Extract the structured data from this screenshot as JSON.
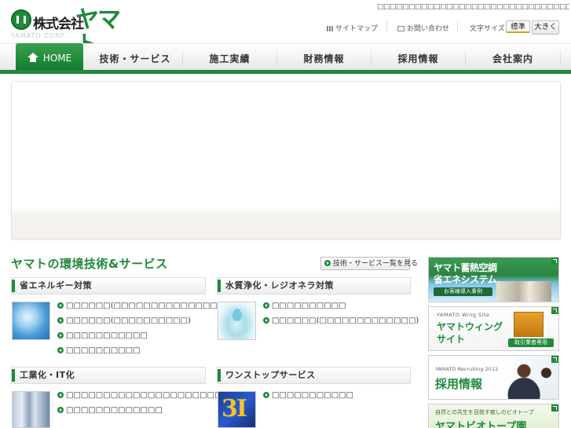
{
  "header": {
    "logo_corp": "株式会社",
    "logo_name": "ヤマト",
    "logo_sub": "YAMATO CORP.",
    "tagline": "□□□□□□□□□□□□□□□□□□□□□□□□□□□□□□□□□□□ □□□□□□□□□□□□□□□□□□□□□",
    "sitemap": "サイトマップ",
    "contact": "お問い合わせ",
    "font_size_label": "文字サイズ",
    "font_standard": "標準",
    "font_large": "大きく"
  },
  "nav": {
    "home": "HOME",
    "items": [
      "技術・サービス",
      "施工実績",
      "財務情報",
      "採用情報",
      "会社案内"
    ]
  },
  "section": {
    "title": "ヤマトの環境技術&サービス",
    "list_button": "技術・サービス一覧を見る"
  },
  "categories": [
    {
      "title": "省エネルギー対策",
      "links": [
        "□□□□□□(□□□□□□□□□□□□□□□)",
        "□□□□□□(□□□□□□□□□□)",
        "□□□□□□□□□□□",
        "□□□□□□□□□□"
      ]
    },
    {
      "title": "水質浄化・レジオネラ対策",
      "links": [
        "□□□□□□□□□□",
        "□□□□□□(□□□□□□□□□□□□□)"
      ]
    },
    {
      "title": "工業化・IT化",
      "links": [
        "□□□□□□□□□□□□□□□□□□□□□",
        "□□□□□□□□□□□□□"
      ]
    },
    {
      "title": "ワンストップサービス",
      "links": [
        "□□□□□□□□□□□"
      ],
      "thumb_text": "3I"
    }
  ],
  "banners": {
    "thermal": {
      "line1": "ヤマト蓄熱空調",
      "line2": "省エネシステム",
      "tag": "お客様導入事例"
    },
    "wing": {
      "small": "YAMATO Wing Site",
      "line1": "ヤマトウィング",
      "line2": "サイト",
      "tag": "取引業者専用"
    },
    "recruit": {
      "small": "YAMATO Recruiting 2012",
      "title": "採用情報"
    },
    "biotope": {
      "small": "自然との共生を目指す癒しのビオトープ",
      "title": "ヤマトビオトープ園"
    }
  },
  "colors": {
    "brand_green": "#1f8a3a",
    "accent_gold": "#d4a017"
  }
}
